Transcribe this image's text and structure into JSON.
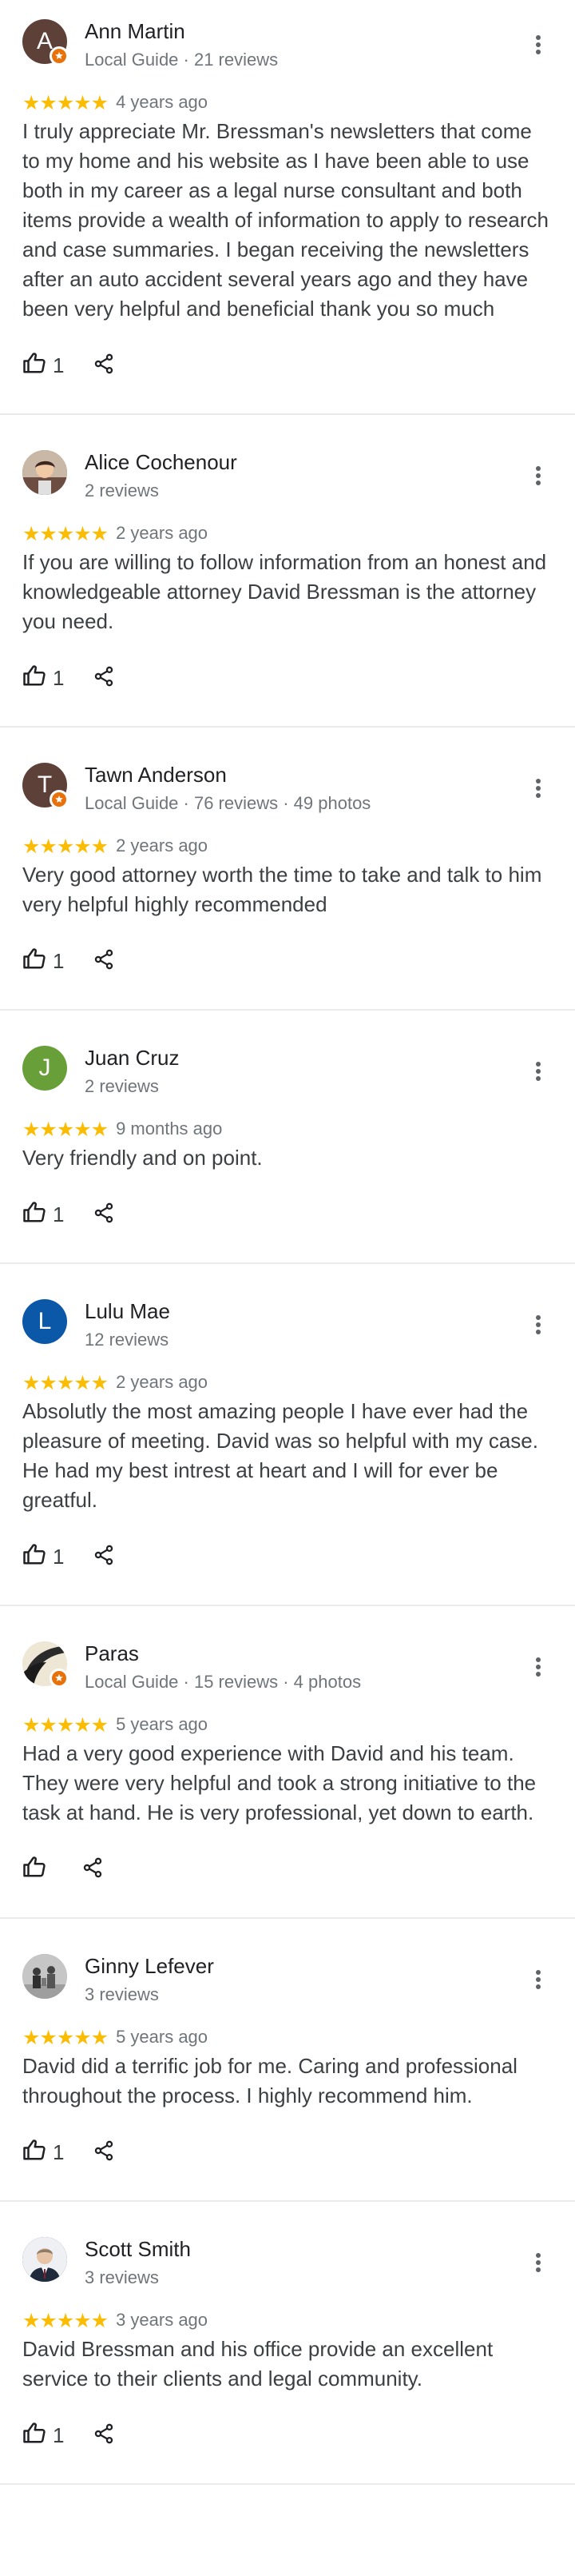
{
  "colors": {
    "star": "#fbbc04",
    "local_guide_badge": "#e8710a",
    "divider": "#ebebeb"
  },
  "icons": {
    "more": "more-vert-icon",
    "like": "thumb-up-icon",
    "share": "share-icon",
    "star": "star-icon",
    "guide": "local-guide-badge-icon"
  },
  "reviews": [
    {
      "name": "Ann Martin",
      "meta": "Local Guide · 21 reviews",
      "avatar": {
        "type": "letter",
        "letter": "A",
        "color": "#5d4037"
      },
      "local_guide": true,
      "stars": "★★★★★",
      "rating": 5,
      "time": "4 years ago",
      "text": "I truly appreciate Mr. Bressman's newsletters that come to my home and his website as I have been able to use both in my career as a legal nurse consultant and both items provide a wealth of information to apply to research and case summaries. I began receiving the newsletters after an auto accident several years ago and they have been very helpful and beneficial thank you so much",
      "likes": "1"
    },
    {
      "name": "Alice Cochenour",
      "meta": "2 reviews",
      "avatar": {
        "type": "photo",
        "icon": "person-photo",
        "color": "#8d6e63"
      },
      "local_guide": false,
      "stars": "★★★★★",
      "rating": 5,
      "time": "2 years ago",
      "text": "If you are willing to follow  information from an honest and knowledgeable  attorney David Bressman is the attorney you need.",
      "likes": "1"
    },
    {
      "name": "Tawn Anderson",
      "meta": "Local Guide · 76 reviews · 49 photos",
      "avatar": {
        "type": "letter",
        "letter": "T",
        "color": "#5d4037"
      },
      "local_guide": true,
      "stars": "★★★★★",
      "rating": 5,
      "time": "2 years ago",
      "text": "Very good attorney worth the time to take and talk to him very helpful highly recommended",
      "likes": "1"
    },
    {
      "name": "Juan Cruz",
      "meta": "2 reviews",
      "avatar": {
        "type": "letter",
        "letter": "J",
        "color": "#689f38"
      },
      "local_guide": false,
      "stars": "★★★★★",
      "rating": 5,
      "time": "9 months ago",
      "text": "Very friendly and on point.",
      "likes": "1"
    },
    {
      "name": "Lulu Mae",
      "meta": "12 reviews",
      "avatar": {
        "type": "letter",
        "letter": "L",
        "color": "#0b57a8"
      },
      "local_guide": false,
      "stars": "★★★★★",
      "rating": 5,
      "time": "2 years ago",
      "text": "Absolutly the most amazing people I have ever had the pleasure of meeting. David was so helpful with my case. He had my best intrest at heart and I will for ever be greatful.",
      "likes": "1"
    },
    {
      "name": "Paras",
      "meta": "Local Guide · 15 reviews · 4 photos",
      "avatar": {
        "type": "photo",
        "icon": "dark-arc-photo",
        "color": "#e8e0d0"
      },
      "local_guide": true,
      "stars": "★★★★★",
      "rating": 5,
      "time": "5 years ago",
      "text": "Had a very good experience with David and his team. They were very helpful and took a strong initiative to the task at hand. He is very professional, yet down to earth.",
      "likes": ""
    },
    {
      "name": "Ginny Lefever",
      "meta": "3 reviews",
      "avatar": {
        "type": "photo",
        "icon": "group-photo",
        "color": "#b0b0b0"
      },
      "local_guide": false,
      "stars": "★★★★★",
      "rating": 5,
      "time": "5 years ago",
      "text": "David did a terrific job for me.  Caring and professional throughout the process.  I highly recommend him.",
      "likes": "1"
    },
    {
      "name": "Scott Smith",
      "meta": "3 reviews",
      "avatar": {
        "type": "photo",
        "icon": "suit-portrait-photo",
        "color": "#1c2230"
      },
      "local_guide": false,
      "stars": "★★★★★",
      "rating": 5,
      "time": "3 years ago",
      "text": "David Bressman and his office provide an excellent service to their clients and legal community.",
      "likes": "1"
    }
  ]
}
